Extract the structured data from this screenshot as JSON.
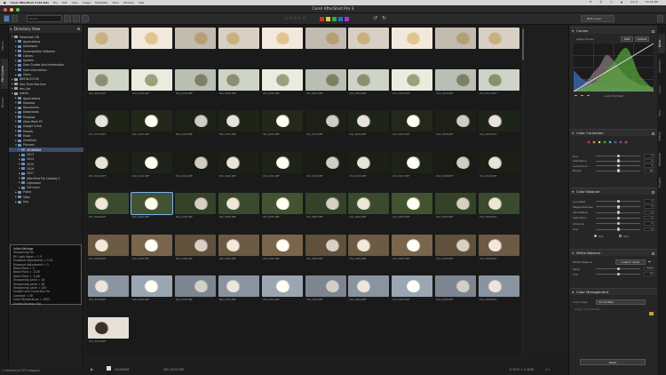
{
  "mac_menu": {
    "items": [
      "●",
      "Corel AfterShot 3 (64-bit)",
      "File",
      "Edit",
      "View",
      "Image",
      "Metadata",
      "Tools",
      "Window",
      "Help"
    ],
    "right": [
      "✷",
      "⦿",
      "○",
      "▲",
      "Jun 6",
      "10:12 AM"
    ]
  },
  "window": {
    "title": "Corel AfterShot Pro 3"
  },
  "toolbar": {
    "search_placeholder": "Search",
    "stars": "☆☆☆☆☆",
    "color_labels": [
      "#cc3333",
      "#d9cc33",
      "#33aa44",
      "#3366cc",
      "#aa33cc"
    ],
    "right_select": "Both Layer"
  },
  "left_tabs": [
    "Library",
    "File System",
    "Browse"
  ],
  "directory": {
    "title": "Directory View",
    "items": [
      {
        "label": "Macintosh HD",
        "depth": 0,
        "expanded": true
      },
      {
        "label": "Applications",
        "depth": 1
      },
      {
        "label": "Developer",
        "depth": 1
      },
      {
        "label": "Incompatible Software",
        "depth": 1
      },
      {
        "label": "Library",
        "depth": 1
      },
      {
        "label": "System",
        "depth": 1
      },
      {
        "label": "User Guides And Information",
        "depth": 1
      },
      {
        "label": "User Information",
        "depth": 1
      },
      {
        "label": "Users",
        "depth": 1
      },
      {
        "label": "NIKON D7100",
        "depth": 0
      },
      {
        "label": "Mac Time Machine",
        "depth": 0
      },
      {
        "label": "dev_ida",
        "depth": 0
      },
      {
        "label": "ardsm",
        "depth": 0,
        "expanded": true
      },
      {
        "label": "Applications",
        "depth": 1
      },
      {
        "label": "Desktop",
        "depth": 1
      },
      {
        "label": "Documents",
        "depth": 1
      },
      {
        "label": "Downloads",
        "depth": 1
      },
      {
        "label": "Dropbox",
        "depth": 1
      },
      {
        "label": "Glow Work PC",
        "depth": 1
      },
      {
        "label": "Google Drive",
        "depth": 1
      },
      {
        "label": "Movies",
        "depth": 1
      },
      {
        "label": "Music",
        "depth": 1
      },
      {
        "label": "OneDrive",
        "depth": 1
      },
      {
        "label": "Pictures",
        "depth": 1,
        "expanded": true
      },
      {
        "label": "20180606",
        "depth": 2,
        "selected": true
      },
      {
        "label": "2013",
        "depth": 2
      },
      {
        "label": "2014",
        "depth": 2
      },
      {
        "label": "2015",
        "depth": 2
      },
      {
        "label": "2016",
        "depth": 2
      },
      {
        "label": "2017",
        "depth": 2
      },
      {
        "label": "AfterShot Pro Catalog 3",
        "depth": 2
      },
      {
        "label": "Lightroom",
        "depth": 2
      },
      {
        "label": "Old icons",
        "depth": 2
      },
      {
        "label": "Public",
        "depth": 1
      },
      {
        "label": "Sites",
        "depth": 1
      },
      {
        "label": "tmp",
        "depth": 1
      }
    ]
  },
  "info_box": {
    "lines": [
      "Initial Settings",
      "Sharpening On",
      "Fill Light Value = 1.5",
      "Exposure Adjustment = 0.25",
      "Exposure Adjustment = 0",
      "Black Point = 0",
      "Black Point = -0.26",
      "Black Point = -0.48",
      "Sharpening Level = 18",
      "Sharpening Level = 36",
      "Sharpening Level = 100",
      "Enable Lens Correction On",
      "Contrast = 26",
      "Color Temperature = 3453",
      "Enable Develop Ops"
    ]
  },
  "thumbnails": {
    "rows": [
      {
        "bg": "#d8d0c4",
        "fl": "#c9b080",
        "caps": [
          "",
          "",
          "",
          "",
          "",
          "",
          "",
          "",
          "",
          "",
          ""
        ]
      },
      {
        "bg": "#cfd4c8",
        "fl": "#8a8f70",
        "caps": [
          "DSC_8201.NEF",
          "DSC_8203.NEF",
          "DSC_8204.NEF",
          "DSC_8205.NEF",
          "DSC_8206.NEF",
          "DSC_8207.NEF",
          "DSC_8208.NEF",
          "DSC_8209.NEF",
          "DSC_8210.NEF",
          "DSC_8211.NEF",
          "DSC_8212.NEF"
        ]
      },
      {
        "bg": "#1f2418",
        "fl": "#e6e4dc",
        "caps": [
          "DSC_8220.NEF",
          "DSC_8221.NEF",
          "DSC_8222.NEF",
          "DSC_8223.NEF",
          "DSC_8224.NEF",
          "DSC_8225.NEF",
          "DSC_8226.NEF",
          "DSC_8227.NEF",
          "DSC_8228.NEF",
          "DSC_8229.NEF",
          "DSC_8230.NEF"
        ]
      },
      {
        "bg": "#1b1f16",
        "fl": "#e8e4da",
        "caps": [
          "DSC_8240.NEF",
          "DSC_8241.NEF",
          "DSC_8242.NEF",
          "DSC_8243.NEF",
          "DSC_8244.NEF",
          "DSC_8245.NEF",
          "DSC_8246.NEF",
          "DSC_8247.NEF",
          "DSC_8248.NEF",
          "DSC_8249.NEF",
          "DSC_8250.NEF"
        ]
      },
      {
        "bg": "#3a4a2c",
        "fl": "#efe6d8",
        "caps": [
          "DSC_8260.NEF",
          "DSC_8261.NEF",
          "DSC_8262.NEF",
          "DSC_8263.NEF",
          "DSC_8264.NEF",
          "DSC_8265.NEF",
          "DSC_8266.NEF",
          "DSC_8267.NEF",
          "DSC_8268.NEF",
          "DSC_8269.NEF",
          "DSC_8270.NEF"
        ]
      },
      {
        "bg": "#6b5a44",
        "fl": "#f2e8dc",
        "caps": [
          "DSC_8280.NEF",
          "DSC_8281.NEF",
          "DSC_8282.NEF",
          "DSC_8283.NEF",
          "DSC_8284.NEF",
          "DSC_8285.NEF",
          "DSC_8286.NEF",
          "DSC_8287.NEF",
          "DSC_8288.NEF",
          "DSC_8289.NEF",
          "DSC_8290.NEF"
        ]
      },
      {
        "bg": "#8a94a0",
        "fl": "#ece6dc",
        "caps": [
          "DSC_8300.NEF",
          "DSC_8301.NEF",
          "DSC_8302.NEF",
          "DSC_8303.NEF",
          "DSC_8304.NEF",
          "DSC_8305.NEF",
          "DSC_8306.NEF",
          "DSC_8307.NEF",
          "DSC_8308.NEF",
          "DSC_8309.NEF",
          "DSC_8310.NEF"
        ]
      },
      {
        "bg": "#e6e0d6",
        "fl": "#3a2e22",
        "caps": [
          "DSC_8320.NEF"
        ]
      }
    ]
  },
  "status": {
    "left": "1 selected of 375 image(s)",
    "folder": "20180606",
    "file": "DSC_8200.NEF",
    "dims": "6 0675 × 2 4048",
    "zoom": "1:1"
  },
  "right_tabs": [
    "Basic",
    "Standard",
    "Color",
    "Tone",
    "Detail",
    "Metadata",
    "Plugins"
  ],
  "curves": {
    "title": "Curves",
    "apply_label": "Apply Curves",
    "channel": "RGB",
    "preset": "Default",
    "auto_contrast": "Auto Contrast",
    "hist_r": [
      2,
      3,
      5,
      8,
      12,
      16,
      20,
      26,
      30,
      34,
      40,
      48,
      52,
      50,
      46,
      40,
      36,
      30,
      26,
      22,
      18,
      16,
      14,
      12,
      10,
      9,
      8,
      8,
      7,
      6
    ],
    "hist_g": [
      2,
      2,
      3,
      4,
      6,
      8,
      10,
      12,
      14,
      18,
      22,
      26,
      30,
      34,
      38,
      44,
      50,
      56,
      60,
      62,
      58,
      50,
      40,
      30,
      22,
      18,
      14,
      10,
      6,
      3
    ],
    "hist_b": [
      30,
      26,
      22,
      18,
      16,
      14,
      12,
      10,
      9,
      8,
      8,
      7,
      6,
      6,
      6,
      5,
      5,
      5,
      4,
      4,
      4,
      4,
      3,
      3,
      3,
      3,
      3,
      3,
      3,
      3
    ]
  },
  "color_correction": {
    "title": "Color Correction",
    "swatches": [
      "#d43a3a",
      "#d8a030",
      "#e0e040",
      "#40b040",
      "#40c0c0",
      "#3060d0",
      "#9040c0",
      "#c040a0"
    ],
    "sliders": [
      "Hue",
      "Saturation",
      "Luminance",
      "Range"
    ],
    "values": [
      "0",
      "0",
      "0",
      "20"
    ]
  },
  "color_balance": {
    "title": "Color Balance",
    "sliders": [
      "Cyan/Red",
      "Magenta/Green",
      "Yellow/Blue",
      "Saturation",
      "Vibrance",
      "Hue"
    ],
    "values": [
      "0",
      "0",
      "0",
      "0",
      "0",
      "0"
    ],
    "radio_hsl": "HSL",
    "radio_hsv": "HSV"
  },
  "white_balance": {
    "title": "White Balance",
    "mode_label": "White Balance",
    "mode_value": "Custom Value",
    "sliders": [
      "Temp",
      "Tint"
    ],
    "values": [
      "3453",
      "15"
    ]
  },
  "color_management": {
    "title": "Color Management",
    "input_label": "Color Input",
    "input_value": "ICC Profiles",
    "assign_label": "Assign Input Profile"
  },
  "footer_right": {
    "button": "Reset"
  }
}
